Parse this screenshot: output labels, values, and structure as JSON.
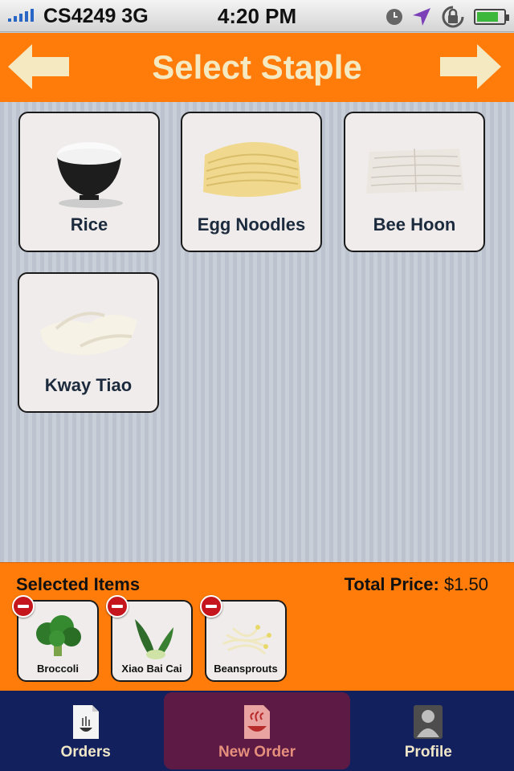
{
  "status_bar": {
    "carrier": "CS4249 3G",
    "time": "4:20 PM",
    "battery_level": 0.8
  },
  "header": {
    "title": "Select Staple",
    "back_icon": "arrow-left-icon",
    "forward_icon": "arrow-right-icon"
  },
  "staples": [
    {
      "label": "Rice",
      "icon": "rice-bowl-icon"
    },
    {
      "label": "Egg Noodles",
      "icon": "egg-noodles-icon"
    },
    {
      "label": "Bee Hoon",
      "icon": "bee-hoon-icon"
    },
    {
      "label": "Kway Tiao",
      "icon": "kway-tiao-icon"
    }
  ],
  "tray": {
    "title": "Selected Items",
    "total_label": "Total Price:",
    "total_value": "$1.50",
    "items": [
      {
        "label": "Broccoli",
        "icon": "broccoli-icon"
      },
      {
        "label": "Xiao Bai Cai",
        "icon": "bok-choy-icon"
      },
      {
        "label": "Beansprouts",
        "icon": "beansprouts-icon"
      }
    ]
  },
  "tabbar": {
    "tabs": [
      {
        "label": "Orders",
        "icon": "orders-icon"
      },
      {
        "label": "New Order",
        "icon": "new-order-icon",
        "active": true
      },
      {
        "label": "Profile",
        "icon": "profile-icon"
      }
    ]
  },
  "colors": {
    "accent": "#ff7c0a",
    "header_text": "#f5e9c2",
    "tabbar": "#13205e",
    "tab_active": "#5c1a45"
  }
}
